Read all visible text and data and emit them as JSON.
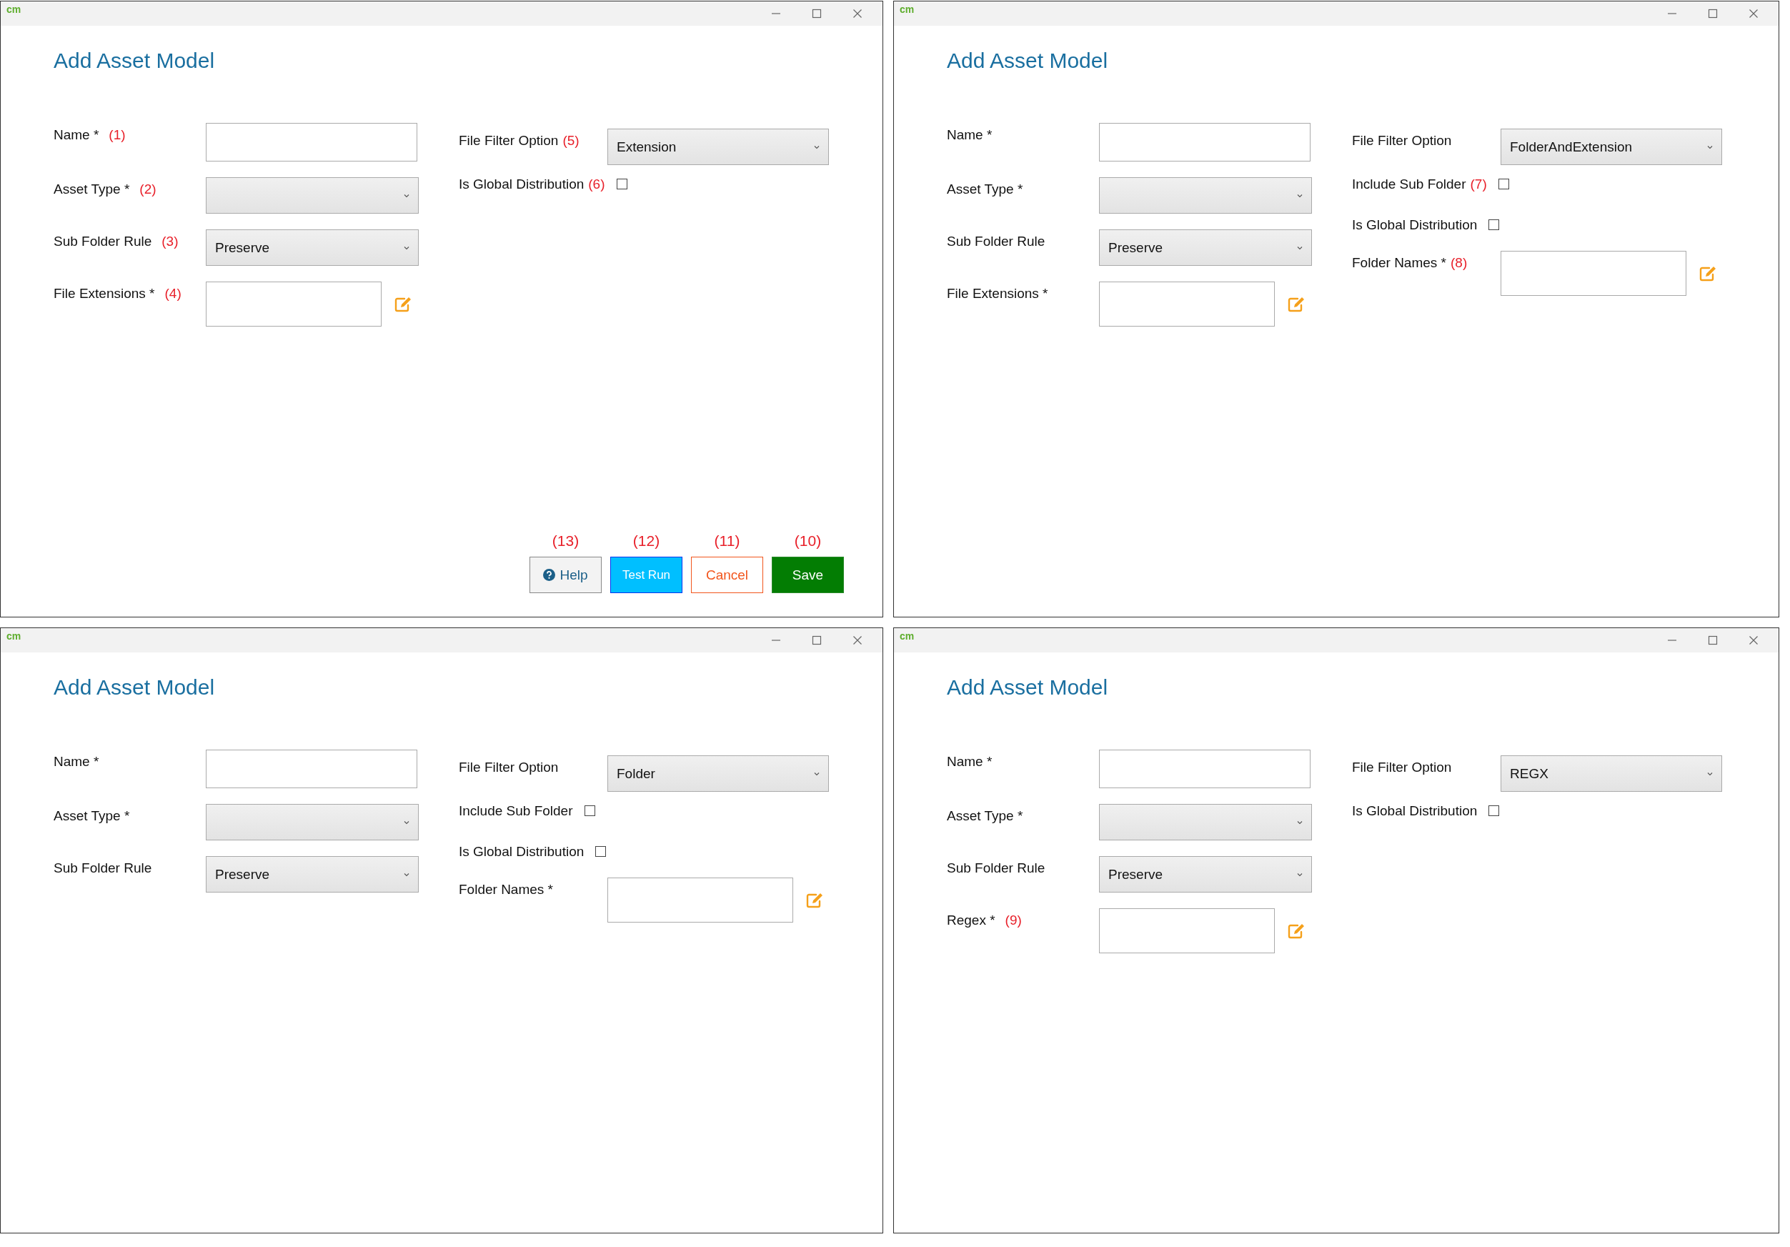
{
  "windows": [
    {
      "logo": "cm",
      "title": "Add Asset Model",
      "left_fields": [
        {
          "kind": "text",
          "label": "Name *",
          "annotation": "(1)"
        },
        {
          "kind": "select",
          "label": "Asset Type *",
          "annotation": "(2)"
        },
        {
          "kind": "select",
          "label": "Sub Folder Rule",
          "annotation": "(3)",
          "value": "Preserve"
        },
        {
          "kind": "multi",
          "label": "File Extensions *",
          "annotation": "(4)"
        }
      ],
      "right_fields": [
        {
          "kind": "select",
          "label": "File Filter Option",
          "annotation": "(5)",
          "value": "Extension"
        },
        {
          "kind": "checkbox",
          "label": "Is Global Distribution",
          "annotation": "(6)",
          "checked": false
        }
      ],
      "buttons": [
        {
          "kind": "help",
          "label": "Help",
          "annotation": "(13)"
        },
        {
          "kind": "primary",
          "label": "Test Run",
          "annotation": "(12)"
        },
        {
          "kind": "outline",
          "label": "Cancel",
          "annotation": "(11)"
        },
        {
          "kind": "success",
          "label": "Save",
          "annotation": "(10)"
        }
      ]
    },
    {
      "logo": "cm",
      "title": "Add Asset Model",
      "left_fields": [
        {
          "kind": "text",
          "label": "Name *"
        },
        {
          "kind": "select",
          "label": "Asset Type *"
        },
        {
          "kind": "select",
          "label": "Sub Folder Rule",
          "value": "Preserve"
        },
        {
          "kind": "multi",
          "label": "File Extensions *"
        }
      ],
      "right_fields": [
        {
          "kind": "select",
          "label": "File Filter Option",
          "value": "FolderAndExtension"
        },
        {
          "kind": "checkbox",
          "label": "Include Sub Folder",
          "annotation": "(7)",
          "checked": false
        },
        {
          "kind": "checkbox",
          "label": "Is Global Distribution",
          "checked": false
        },
        {
          "kind": "multi",
          "label": "Folder Names *",
          "annotation": "(8)"
        }
      ]
    },
    {
      "logo": "cm",
      "title": "Add Asset Model",
      "left_fields": [
        {
          "kind": "text",
          "label": "Name *"
        },
        {
          "kind": "select",
          "label": "Asset Type *"
        },
        {
          "kind": "select",
          "label": "Sub Folder Rule",
          "value": "Preserve"
        }
      ],
      "right_fields": [
        {
          "kind": "select",
          "label": "File Filter Option",
          "value": "Folder"
        },
        {
          "kind": "checkbox",
          "label": "Include Sub Folder",
          "checked": false
        },
        {
          "kind": "checkbox",
          "label": "Is Global Distribution",
          "checked": false
        },
        {
          "kind": "multi",
          "label": "Folder Names *"
        }
      ]
    },
    {
      "logo": "cm",
      "title": "Add Asset Model",
      "left_fields": [
        {
          "kind": "text",
          "label": "Name *"
        },
        {
          "kind": "select",
          "label": "Asset Type *"
        },
        {
          "kind": "select",
          "label": "Sub Folder Rule",
          "value": "Preserve"
        },
        {
          "kind": "multi",
          "label": "Regex *",
          "annotation": "(9)"
        }
      ],
      "right_fields": [
        {
          "kind": "select",
          "label": "File Filter Option",
          "value": "REGX"
        },
        {
          "kind": "checkbox",
          "label": "Is Global Distribution",
          "checked": false
        }
      ]
    }
  ]
}
